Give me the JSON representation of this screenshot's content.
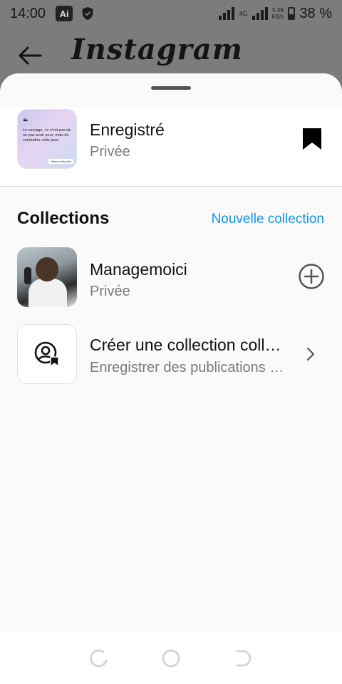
{
  "status_bar": {
    "time": "14:00",
    "ai_badge": "Ai",
    "network": "4G",
    "speed_value": "5.39",
    "speed_unit": "KB/s",
    "battery": "38 %",
    "icons": [
      "ai-app-icon",
      "shield-icon",
      "signal-icon",
      "signal-icon",
      "battery-icon"
    ]
  },
  "app_header": {
    "logo": "Instagram",
    "back_icon": "back-arrow-icon"
  },
  "saved": {
    "title": "Enregistré",
    "subtitle": "Privée",
    "thumb_quote": "Le courage, ce n'est pas de ne pas avoir peur, mais de combattre cette peur",
    "thumb_author": "Nelson Mandela",
    "icon": "bookmark-icon"
  },
  "collections": {
    "title": "Collections",
    "new_label": "Nouvelle collection",
    "items": [
      {
        "title": "Managemoici",
        "subtitle": "Privée",
        "action_icon": "add-circle-icon"
      },
      {
        "title": "Créer une collection coll…",
        "subtitle": "Enregistrer des publications …",
        "action_icon": "chevron-right-icon"
      }
    ]
  },
  "colors": {
    "accent": "#0f95f0",
    "dim": "#7c7c7c",
    "sheet_bg": "#fafafa"
  },
  "navbar": {
    "icons": [
      "recent-apps-icon",
      "home-icon",
      "back-icon"
    ]
  }
}
